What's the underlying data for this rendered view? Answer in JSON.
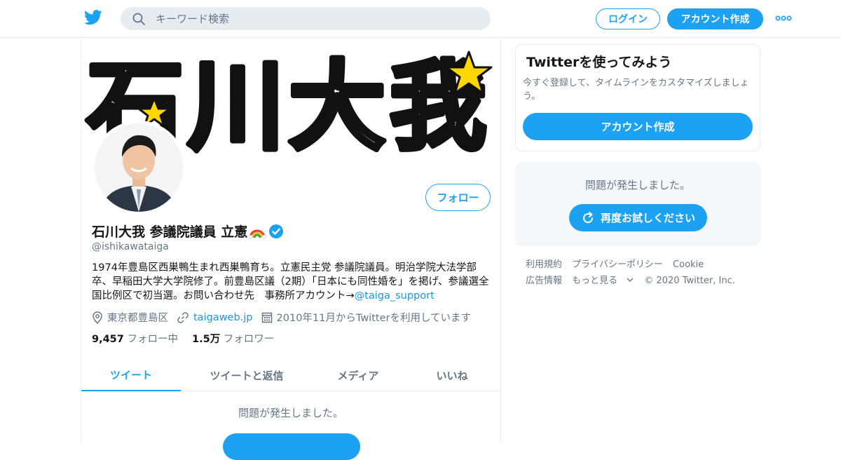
{
  "topbar": {
    "search_placeholder": "キーワード検索",
    "login_label": "ログイン",
    "signup_label": "アカウント作成"
  },
  "profile": {
    "banner_text": "石川大我",
    "follow_label": "フォロー",
    "name": "石川大我 参議院議員 立憲",
    "handle": "@ishikawataiga",
    "bio_text": "1974年豊島区西巣鴨生まれ西巣鴨育ち。立憲民主党 参議院議員。明治学院大法学部卒、早稲田大学大学院修了。前豊島区議（2期）「日本にも同性婚を」を掲げ、参議選全国比例区で初当選。お問い合わせ先　事務所アカウント→",
    "bio_link": "@taiga_support",
    "location": "東京都豊島区",
    "website": "taigaweb.jp",
    "joined": "2010年11月からTwitterを利用しています",
    "following_count": "9,457",
    "following_label": "フォロー中",
    "followers_count": "1.5万",
    "followers_label": "フォロワー"
  },
  "tabs": [
    {
      "label": "ツイート",
      "active": true
    },
    {
      "label": "ツイートと返信",
      "active": false
    },
    {
      "label": "メディア",
      "active": false
    },
    {
      "label": "いいね",
      "active": false
    }
  ],
  "main_error": {
    "message": "問題が発生しました。"
  },
  "signup_card": {
    "title": "Twitterを使ってみよう",
    "description": "今すぐ登録して、タイムラインをカスタマイズしましょう。",
    "button_label": "アカウント作成"
  },
  "error_card": {
    "message": "問題が発生しました。",
    "retry_label": "再度お試しください"
  },
  "footer": {
    "links": [
      "利用規約",
      "プライバシーポリシー",
      "Cookie",
      "広告情報",
      "もっと見る"
    ],
    "copyright": "© 2020 Twitter, Inc."
  },
  "colors": {
    "accent": "#1da1f2",
    "link": "#1b95e0",
    "secondary_text": "#657786",
    "border": "#e6ecf0",
    "star": "#ffd700"
  }
}
